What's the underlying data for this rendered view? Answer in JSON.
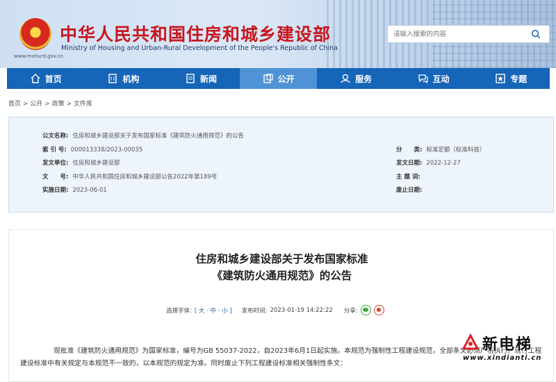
{
  "header": {
    "site_url": "www.mohurd.gov.cn",
    "title": "中华人民共和国住房和城乡建设部",
    "subtitle": "Ministry of Housing and Urban-Rural Development of the People's Republic of China",
    "search_placeholder": "请输入搜索的内容"
  },
  "nav": [
    {
      "label": "首页",
      "icon": "home-icon"
    },
    {
      "label": "机构",
      "icon": "building-icon"
    },
    {
      "label": "新闻",
      "icon": "news-icon"
    },
    {
      "label": "公开",
      "icon": "disclosure-icon",
      "active": true
    },
    {
      "label": "服务",
      "icon": "service-icon"
    },
    {
      "label": "互动",
      "icon": "interaction-icon"
    },
    {
      "label": "专题",
      "icon": "topic-icon"
    }
  ],
  "breadcrumb": [
    "首页",
    "公开",
    "政策",
    "文件库"
  ],
  "info": {
    "doc_name_label": "公文名称:",
    "doc_name": "住房和城乡建设部关于发布国家标准《建筑防火通用规范》的公告",
    "index_label": "索 引 号:",
    "index": "000013338/2023-00035",
    "category_label": "分　　类:",
    "category": "标准定额（标准科技）",
    "issuer_label": "发文单位:",
    "issuer": "住房和城乡建设部",
    "issue_date_label": "发文日期:",
    "issue_date": "2022-12-27",
    "doc_no_label": "文　　号:",
    "doc_no": "中华人民共和国住房和城乡建设部公告2022年第189号",
    "keywords_label": "主 题 词:",
    "keywords": "",
    "effective_label": "实施日期:",
    "effective": "2023-06-01",
    "abolish_label": "废止日期:",
    "abolish": ""
  },
  "article": {
    "title_line1": "住房和城乡建设部关于发布国家标准",
    "title_line2": "《建筑防火通用规范》的公告",
    "font_label": "选择字体:",
    "font_options": "[ 大 · 中 · 小 ]",
    "publish_label": "发布时间:",
    "publish_time": "2023-01-19 14:22:22",
    "share_label": "分享:",
    "body": "现批准《建筑防火通用规范》为国家标准，编号为GB 55037-2022，自2023年6月1日起实施。本规范为强制性工程建设规范，全部条文必须严格执行。现行工程建设标准中有关规定与本规范不一致的，以本规范的规定为准。同时废止下列工程建设标准相关强制性条文："
  },
  "watermark": {
    "text": "新电梯",
    "url": "www.xindianti.cn"
  },
  "colors": {
    "nav_bg": "#1565b8",
    "nav_active": "#4f93d6",
    "title_red": "#c8161d",
    "info_bg": "#eef4fb"
  }
}
